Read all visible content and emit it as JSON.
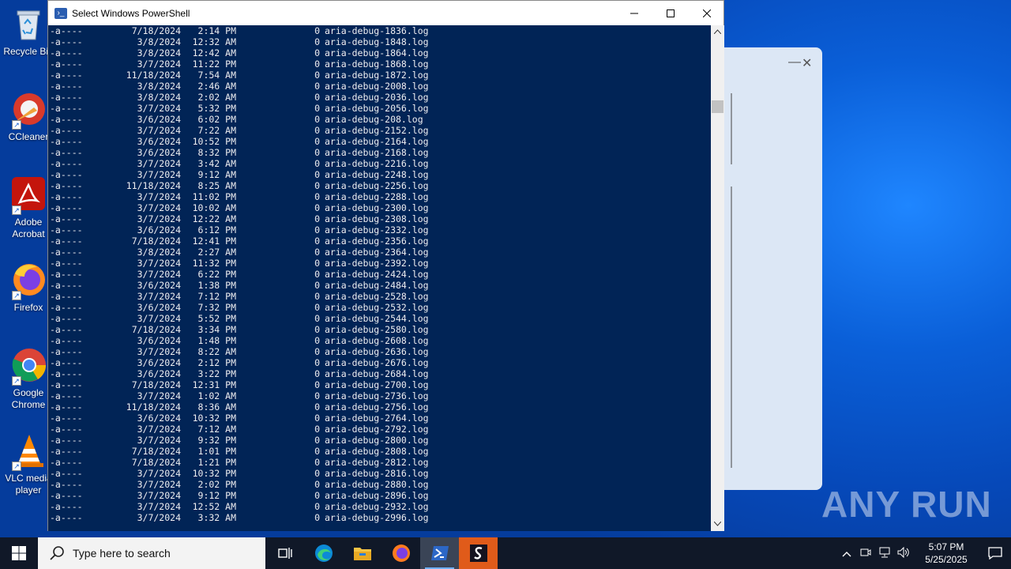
{
  "desktop_icons": [
    {
      "label": "Recycle Bin",
      "name": "recycle-bin"
    },
    {
      "label": "CCleaner",
      "name": "ccleaner"
    },
    {
      "label": "Adobe\nAcrobat",
      "name": "adobe-acrobat"
    },
    {
      "label": "Firefox",
      "name": "firefox"
    },
    {
      "label": "Google\nChrome",
      "name": "google-chrome"
    },
    {
      "label": "VLC media\nplayer",
      "name": "vlc"
    }
  ],
  "window": {
    "title": "Select Windows PowerShell",
    "minimize": "—",
    "maximize": "☐",
    "close": "✕"
  },
  "console_rows": [
    [
      "-a----",
      "7/18/2024",
      "2:14 PM",
      "0",
      "aria-debug-1836.log"
    ],
    [
      "-a----",
      "3/8/2024",
      "12:32 AM",
      "0",
      "aria-debug-1848.log"
    ],
    [
      "-a----",
      "3/8/2024",
      "12:42 AM",
      "0",
      "aria-debug-1864.log"
    ],
    [
      "-a----",
      "3/7/2024",
      "11:22 PM",
      "0",
      "aria-debug-1868.log"
    ],
    [
      "-a----",
      "11/18/2024",
      "7:54 AM",
      "0",
      "aria-debug-1872.log"
    ],
    [
      "-a----",
      "3/8/2024",
      "2:46 AM",
      "0",
      "aria-debug-2008.log"
    ],
    [
      "-a----",
      "3/8/2024",
      "2:02 AM",
      "0",
      "aria-debug-2036.log"
    ],
    [
      "-a----",
      "3/7/2024",
      "5:32 PM",
      "0",
      "aria-debug-2056.log"
    ],
    [
      "-a----",
      "3/6/2024",
      "6:02 PM",
      "0",
      "aria-debug-208.log"
    ],
    [
      "-a----",
      "3/7/2024",
      "7:22 AM",
      "0",
      "aria-debug-2152.log"
    ],
    [
      "-a----",
      "3/6/2024",
      "10:52 PM",
      "0",
      "aria-debug-2164.log"
    ],
    [
      "-a----",
      "3/6/2024",
      "8:32 PM",
      "0",
      "aria-debug-2168.log"
    ],
    [
      "-a----",
      "3/7/2024",
      "3:42 AM",
      "0",
      "aria-debug-2216.log"
    ],
    [
      "-a----",
      "3/7/2024",
      "9:12 AM",
      "0",
      "aria-debug-2248.log"
    ],
    [
      "-a----",
      "11/18/2024",
      "8:25 AM",
      "0",
      "aria-debug-2256.log"
    ],
    [
      "-a----",
      "3/7/2024",
      "11:02 PM",
      "0",
      "aria-debug-2288.log"
    ],
    [
      "-a----",
      "3/7/2024",
      "10:02 AM",
      "0",
      "aria-debug-2300.log"
    ],
    [
      "-a----",
      "3/7/2024",
      "12:22 AM",
      "0",
      "aria-debug-2308.log"
    ],
    [
      "-a----",
      "3/6/2024",
      "6:12 PM",
      "0",
      "aria-debug-2332.log"
    ],
    [
      "-a----",
      "7/18/2024",
      "12:41 PM",
      "0",
      "aria-debug-2356.log"
    ],
    [
      "-a----",
      "3/8/2024",
      "2:27 AM",
      "0",
      "aria-debug-2364.log"
    ],
    [
      "-a----",
      "3/7/2024",
      "11:32 PM",
      "0",
      "aria-debug-2392.log"
    ],
    [
      "-a----",
      "3/7/2024",
      "6:22 PM",
      "0",
      "aria-debug-2424.log"
    ],
    [
      "-a----",
      "3/6/2024",
      "1:38 PM",
      "0",
      "aria-debug-2484.log"
    ],
    [
      "-a----",
      "3/7/2024",
      "7:12 PM",
      "0",
      "aria-debug-2528.log"
    ],
    [
      "-a----",
      "3/6/2024",
      "7:32 PM",
      "0",
      "aria-debug-2532.log"
    ],
    [
      "-a----",
      "3/7/2024",
      "5:52 PM",
      "0",
      "aria-debug-2544.log"
    ],
    [
      "-a----",
      "7/18/2024",
      "3:34 PM",
      "0",
      "aria-debug-2580.log"
    ],
    [
      "-a----",
      "3/6/2024",
      "1:48 PM",
      "0",
      "aria-debug-2608.log"
    ],
    [
      "-a----",
      "3/7/2024",
      "8:22 AM",
      "0",
      "aria-debug-2636.log"
    ],
    [
      "-a----",
      "3/6/2024",
      "2:12 PM",
      "0",
      "aria-debug-2676.log"
    ],
    [
      "-a----",
      "3/6/2024",
      "3:22 PM",
      "0",
      "aria-debug-2684.log"
    ],
    [
      "-a----",
      "7/18/2024",
      "12:31 PM",
      "0",
      "aria-debug-2700.log"
    ],
    [
      "-a----",
      "3/7/2024",
      "1:02 AM",
      "0",
      "aria-debug-2736.log"
    ],
    [
      "-a----",
      "11/18/2024",
      "8:36 AM",
      "0",
      "aria-debug-2756.log"
    ],
    [
      "-a----",
      "3/6/2024",
      "10:32 PM",
      "0",
      "aria-debug-2764.log"
    ],
    [
      "-a----",
      "3/7/2024",
      "7:12 AM",
      "0",
      "aria-debug-2792.log"
    ],
    [
      "-a----",
      "3/7/2024",
      "9:32 PM",
      "0",
      "aria-debug-2800.log"
    ],
    [
      "-a----",
      "7/18/2024",
      "1:01 PM",
      "0",
      "aria-debug-2808.log"
    ],
    [
      "-a----",
      "7/18/2024",
      "1:21 PM",
      "0",
      "aria-debug-2812.log"
    ],
    [
      "-a----",
      "3/7/2024",
      "10:32 PM",
      "0",
      "aria-debug-2816.log"
    ],
    [
      "-a----",
      "3/7/2024",
      "2:02 PM",
      "0",
      "aria-debug-2880.log"
    ],
    [
      "-a----",
      "3/7/2024",
      "9:12 PM",
      "0",
      "aria-debug-2896.log"
    ],
    [
      "-a----",
      "3/7/2024",
      "12:52 AM",
      "0",
      "aria-debug-2932.log"
    ],
    [
      "-a----",
      "3/7/2024",
      "3:32 AM",
      "0",
      "aria-debug-2996.log"
    ]
  ],
  "bg_dialog": {
    "minimize": "—",
    "close": "✕"
  },
  "watermark": "ANY RUN",
  "taskbar": {
    "search_placeholder": "Type here to search",
    "apps": [
      {
        "name": "task-view",
        "active": false
      },
      {
        "name": "edge",
        "active": false
      },
      {
        "name": "file-explorer",
        "active": false
      },
      {
        "name": "firefox",
        "active": false
      },
      {
        "name": "powershell",
        "active": true
      },
      {
        "name": "app-s",
        "active": false
      }
    ],
    "clock_time": "5:07 PM",
    "clock_date": "5/25/2025"
  }
}
